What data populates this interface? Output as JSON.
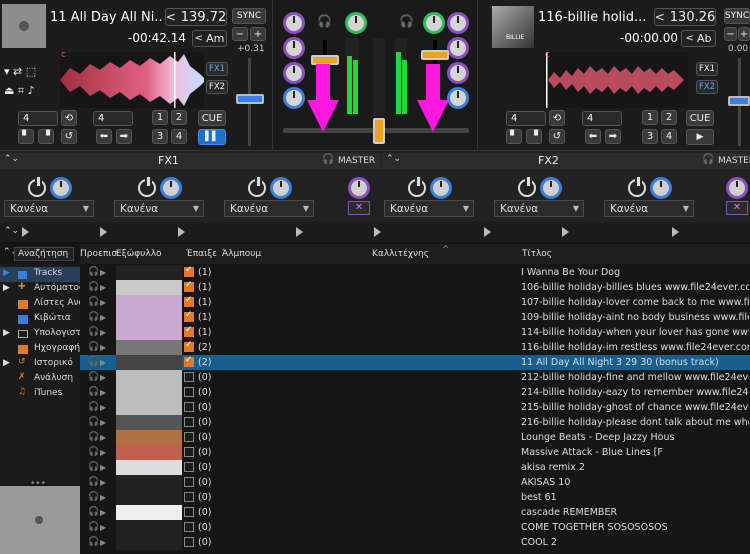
{
  "deck_left": {
    "title": "11 All Day All Ni...",
    "bpm": "139.72",
    "bpm_arrow": "<",
    "time": "-00:42.14",
    "key": "Am",
    "key_arrow": "<",
    "pitch": "+0.31",
    "sync": "SYNC",
    "minus": "−",
    "plus": "+",
    "fx1": "FX1",
    "fx2": "FX2",
    "loop_value": "4",
    "loop_value_2": "4",
    "pad_labels": [
      "1",
      "2",
      "3",
      "4"
    ],
    "cue": "CUE",
    "play": "▌▌",
    "waveform_marker": "C"
  },
  "deck_right": {
    "title": "116-billie holid...",
    "bpm": "130.26",
    "bpm_arrow": "<",
    "time": "-00:00.00",
    "key": "Ab",
    "key_arrow": "<",
    "pitch": "0.00",
    "sync": "SYNC",
    "minus": "−",
    "plus": "+",
    "fx1": "FX1",
    "fx2": "FX2",
    "loop_value": "4",
    "loop_value_2": "4",
    "pad_labels": [
      "1",
      "2",
      "3",
      "4"
    ],
    "cue": "CUE",
    "play": "▶",
    "album_text": "BILLIE",
    "waveform_marker": "C"
  },
  "fx": {
    "fx1_title": "FX1",
    "fx2_title": "FX2",
    "master": "MASTER",
    "slot_option": "Κανένα"
  },
  "browser": {
    "search_placeholder": "Αναζήτηση",
    "columns": {
      "preview": "Προεπισ",
      "cover": "Εξώφυλλο",
      "played": "Έπαιξε",
      "album": "Άλμπουμ",
      "artist": "Καλλιτέχνης",
      "title": "Τίτλος"
    },
    "sort_arrow": "^",
    "sidebar": [
      {
        "label": "Tracks",
        "color": "#3c7ee0"
      },
      {
        "label": "Αυτόματος",
        "color": "#e07a2a"
      },
      {
        "label": "Λίστες Ανα",
        "color": "#e07a2a"
      },
      {
        "label": "Κιβώτια",
        "color": "#3c7ee0"
      },
      {
        "label": "Υπολογιστ",
        "color": "#aaa"
      },
      {
        "label": "Ηχογραφή",
        "color": "#e07a2a"
      },
      {
        "label": "Ιστορικό",
        "color": "#e07a2a"
      },
      {
        "label": "Ανάλυση",
        "color": "#e07a2a"
      },
      {
        "label": "iTunes",
        "color": "#aaa"
      }
    ],
    "rows": [
      {
        "played": "(1)",
        "checked": true,
        "title": "I Wanna Be Your Dog"
      },
      {
        "played": "(1)",
        "checked": true,
        "title": "106-billie holiday-billies blues www.file24ever.com"
      },
      {
        "played": "(1)",
        "checked": true,
        "title": "107-billie holiday-lover come back to me www.file24ever.com"
      },
      {
        "played": "(1)",
        "checked": true,
        "title": "109-billie holiday-aint no body business www.file24ever.com"
      },
      {
        "played": "(1)",
        "checked": true,
        "title": "114-billie holiday-when your lover has gone www.file24ever.c"
      },
      {
        "played": "(2)",
        "checked": true,
        "title": "116-billie holiday-im restless www.file24ever.com"
      },
      {
        "played": "(2)",
        "checked": true,
        "title": "11 All Day All Night  3 29 30 (bonus track)",
        "selected": true
      },
      {
        "played": "(0)",
        "checked": false,
        "title": "212-billie holiday-fine and mellow www.file24ever.com"
      },
      {
        "played": "(0)",
        "checked": false,
        "title": "214-billie holiday-eazy to remember www.file24ever.com"
      },
      {
        "played": "(0)",
        "checked": false,
        "title": "215-billie holiday-ghost of chance www.file24ever.com"
      },
      {
        "played": "(0)",
        "checked": false,
        "title": "216-billie holiday-please dont talk about me when i gone w"
      },
      {
        "played": "(0)",
        "checked": false,
        "title": "Lounge Beats - Deep Jazzy Hous"
      },
      {
        "played": "(0)",
        "checked": false,
        "title": "Massive Attack - Blue Lines [F"
      },
      {
        "played": "(0)",
        "checked": false,
        "title": "akisa remix 2"
      },
      {
        "played": "(0)",
        "checked": false,
        "title": "AKISAS 10"
      },
      {
        "played": "(0)",
        "checked": false,
        "title": "best 61"
      },
      {
        "played": "(0)",
        "checked": false,
        "title": "cascade REMEMBER"
      },
      {
        "played": "(0)",
        "checked": false,
        "title": "COME TOGETHER SOSOSOSOS"
      },
      {
        "played": "(0)",
        "checked": false,
        "title": "COOL 2"
      }
    ]
  },
  "colors": {
    "accent": "#3c7ee0",
    "orange": "#e07a2a",
    "magenta": "#ff18e0",
    "selected_row": "#15608f"
  }
}
